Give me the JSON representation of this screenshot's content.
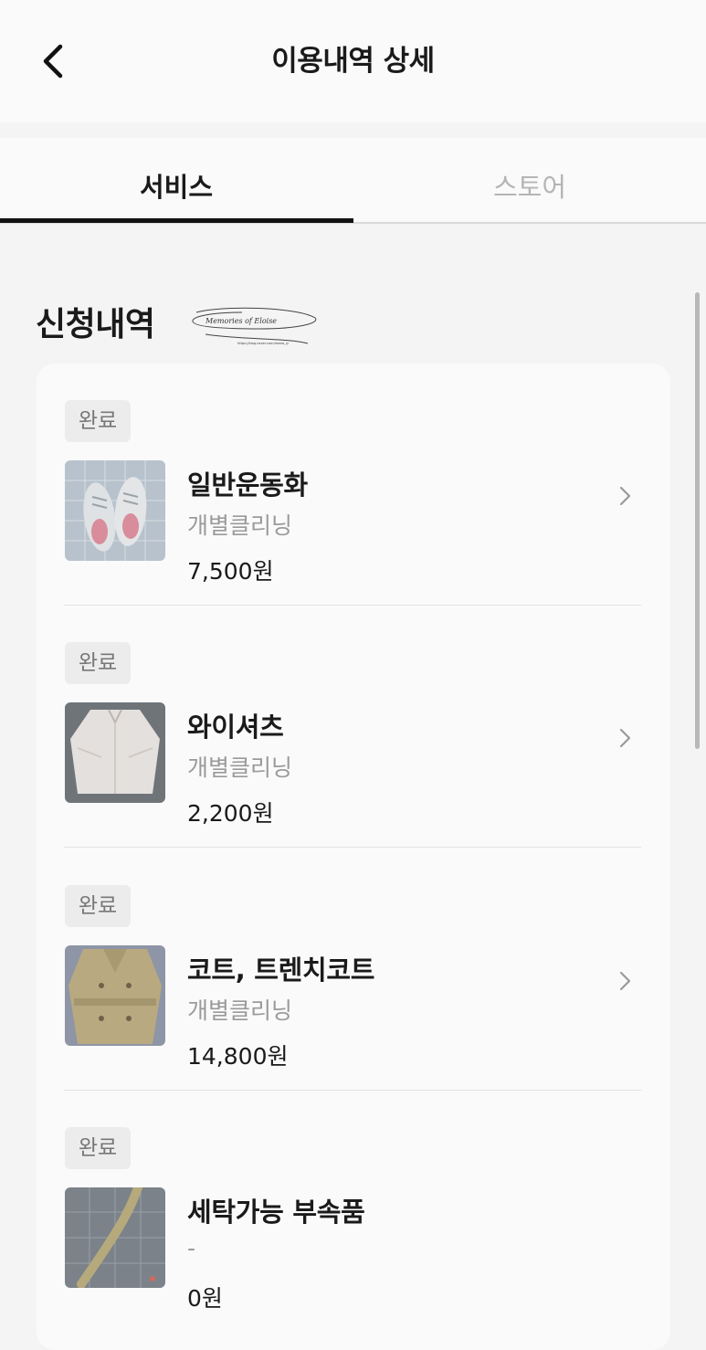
{
  "header": {
    "title": "이용내역 상세"
  },
  "tabs": [
    {
      "label": "서비스",
      "active": true
    },
    {
      "label": "스토어",
      "active": false
    }
  ],
  "section": {
    "title": "신청내역",
    "watermark_text": "Memories of Eloise",
    "watermark_url": "https://blog.naver.com/meow_ly"
  },
  "items": [
    {
      "status": "완료",
      "name": "일반운동화",
      "type": "개별클리닝",
      "price": "7,500원",
      "thumb": "sneakers"
    },
    {
      "status": "완료",
      "name": "와이셔츠",
      "type": "개별클리닝",
      "price": "2,200원",
      "thumb": "dress-shirt"
    },
    {
      "status": "완료",
      "name": "코트, 트렌치코트",
      "type": "개별클리닝",
      "price": "14,800원",
      "thumb": "trench-coat"
    },
    {
      "status": "완료",
      "name": "세탁가능 부속품",
      "type": "-",
      "price": "0원",
      "thumb": "belt"
    }
  ],
  "colors": {
    "background": "#f4f4f4",
    "card": "#fafafa",
    "active_tab": "#1a1a1a",
    "inactive_tab": "#b5b5b5",
    "badge_bg": "#ececec"
  },
  "icons": [
    "chevron-left-icon",
    "chevron-right-icon"
  ]
}
